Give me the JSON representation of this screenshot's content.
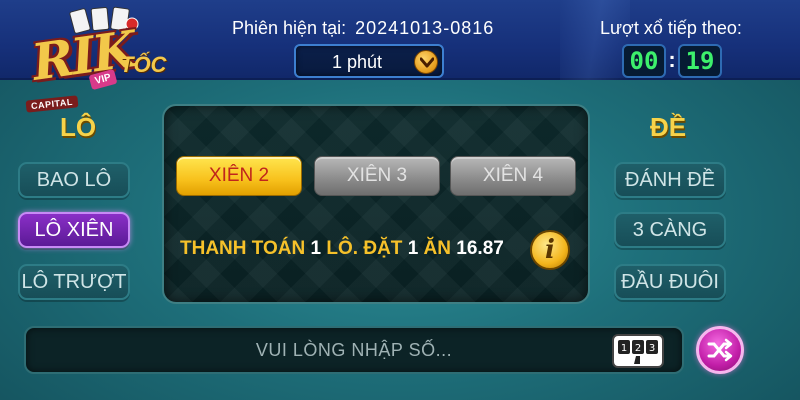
{
  "header": {
    "logo": {
      "wordmark": "RIK",
      "badge": "VIP",
      "sub": "CAPITAL",
      "tag": "TỐC"
    },
    "session_label": "Phiên hiện tại:",
    "session_value": "20241013-0816",
    "period_value": "1 phút",
    "next_draw_label": "Lượt xổ tiếp theo:",
    "timer_minutes": "00",
    "timer_seconds": "19"
  },
  "left": {
    "title": "LÔ",
    "items": [
      {
        "label": "BAO LÔ",
        "active": false
      },
      {
        "label": "LÔ XIÊN",
        "active": true
      },
      {
        "label": "LÔ TRƯỢT",
        "active": false
      }
    ]
  },
  "right": {
    "title": "ĐỀ",
    "items": [
      {
        "label": "ĐÁNH ĐỀ"
      },
      {
        "label": "3 CÀNG"
      },
      {
        "label": "ĐẦU ĐUÔI"
      }
    ]
  },
  "panel": {
    "tabs": [
      {
        "label": "XIÊN 2",
        "active": true
      },
      {
        "label": "XIÊN 3",
        "active": false
      },
      {
        "label": "XIÊN 4",
        "active": false
      }
    ],
    "payout": {
      "prefix": "THANH TOÁN",
      "qty_a": "1",
      "unit_a": "LÔ. ĐẶT",
      "qty_b": "1",
      "unit_b": "ĂN",
      "rate": "16.87"
    }
  },
  "input": {
    "placeholder": "VUI LÒNG NHẬP SỐ..."
  },
  "colors": {
    "accent_yellow": "#f7d34a",
    "active_purple": "#8a2fc7",
    "timer_green": "#3df06c",
    "bg_teal": "#1e6f7a"
  },
  "icons": {
    "period_dropdown": "chevron-down-icon",
    "info": "info-icon",
    "keypad": "keypad-icon",
    "shuffle": "shuffle-icon"
  }
}
